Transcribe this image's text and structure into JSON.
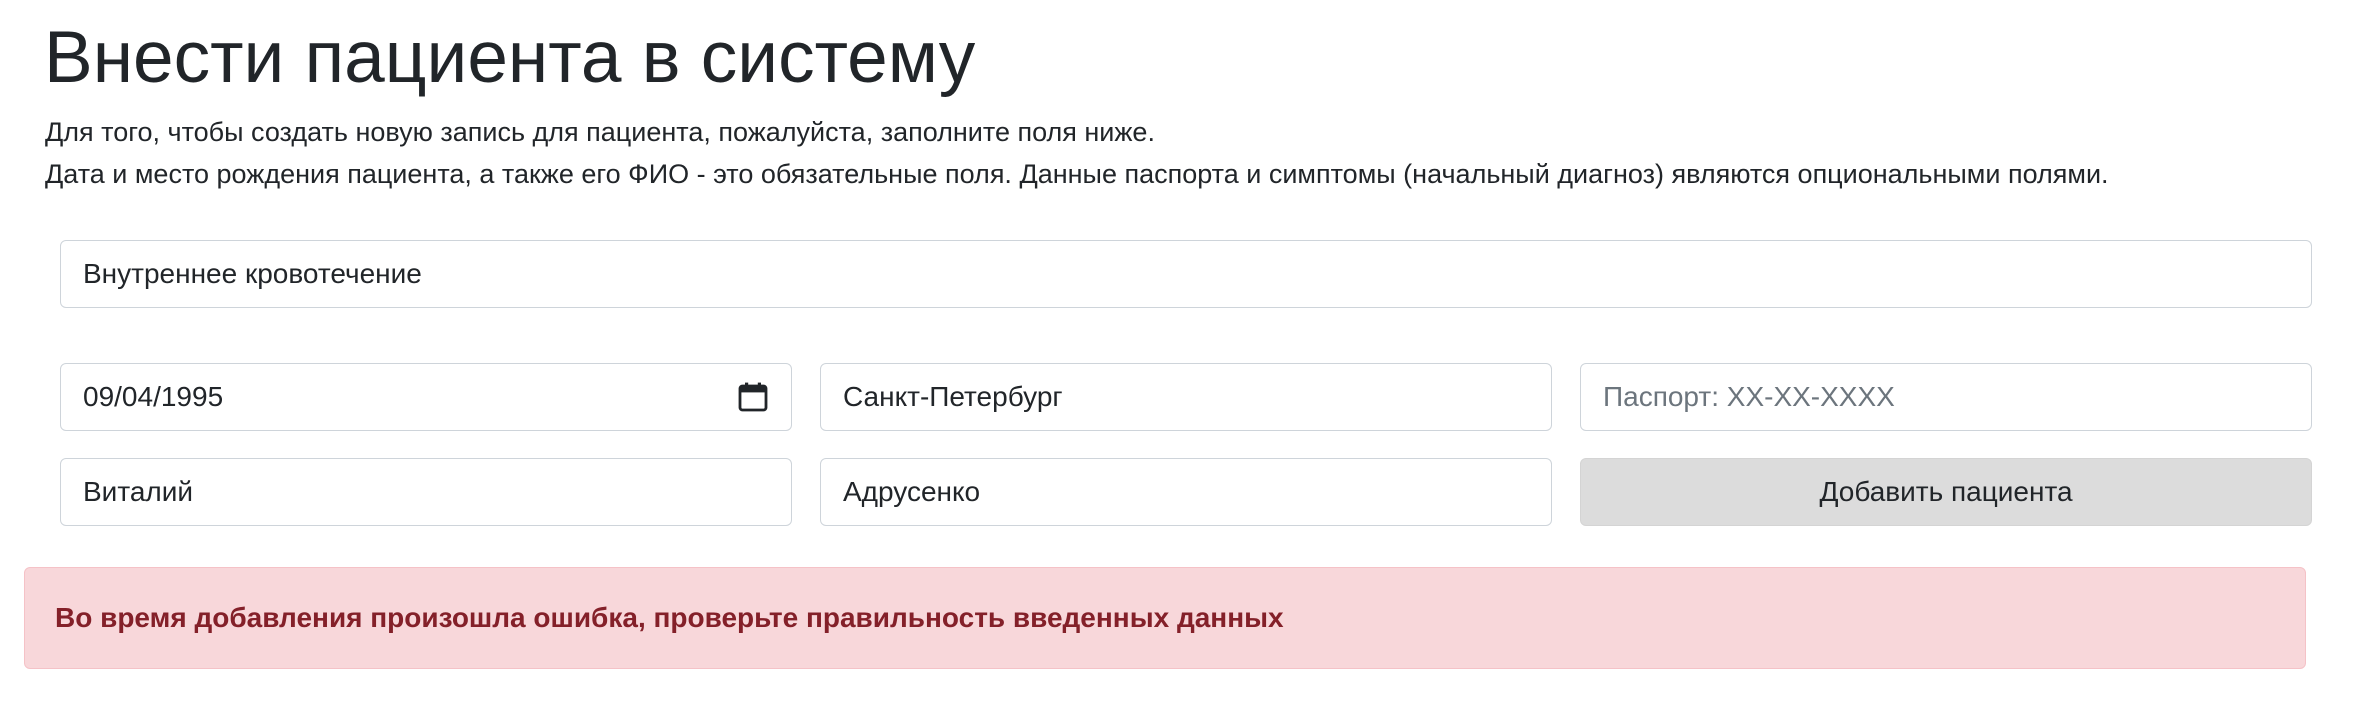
{
  "page": {
    "title": "Внести пациента в систему",
    "intro_line_1": "Для того, чтобы создать новую запись для пациента, пожалуйста, заполните поля ниже.",
    "intro_line_2": "Дата и место рождения пациента, а также его ФИО - это обязательные поля. Данные паспорта и симптомы (начальный диагноз) являются опциональными полями."
  },
  "form": {
    "symptoms_value": "Внутреннее кровотечение",
    "birth_date_value": "09/04/1995",
    "birth_place_value": "Санкт-Петербург",
    "passport_value": "",
    "passport_placeholder": "Паспорт: XX-XX-XXXX",
    "first_name_value": "Виталий",
    "last_name_value": "Адрусенко",
    "submit_label": "Добавить пациента"
  },
  "alert": {
    "message": "Во время добавления произошла ошибка, проверьте правильность введенных данных"
  },
  "icons": {
    "date_picker": "calendar-icon"
  },
  "colors": {
    "alert_background": "#f8d7da",
    "alert_text": "#842029",
    "button_background": "#dcdcdc",
    "input_border": "#ced4da",
    "placeholder_text": "#6c757d"
  }
}
